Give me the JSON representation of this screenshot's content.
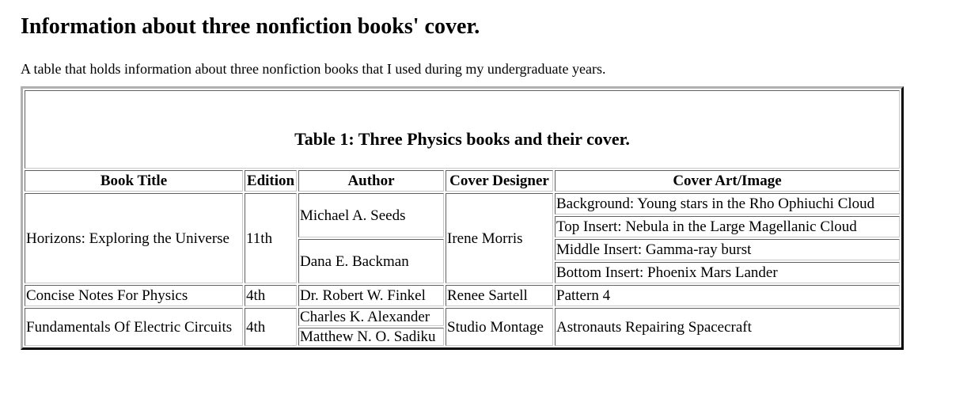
{
  "page": {
    "heading": "Information about three nonfiction books' cover.",
    "description": "A table that holds information about three nonfiction books that I used during my undergraduate years."
  },
  "table": {
    "caption": "Table 1: Three Physics books and their cover.",
    "headers": [
      "Book Title",
      "Edition",
      "Author",
      "Cover Designer",
      "Cover Art/Image"
    ],
    "books": [
      {
        "title": "Horizons: Exploring the Universe",
        "edition": "11th",
        "authors": [
          "Michael A. Seeds",
          "Dana E. Backman"
        ],
        "designer": "Irene Morris",
        "cover_art": [
          "Background: Young stars in the Rho Ophiuchi Cloud",
          "Top Insert: Nebula in the Large Magellanic Cloud",
          "Middle Insert: Gamma-ray burst",
          "Bottom Insert: Phoenix Mars Lander"
        ]
      },
      {
        "title": "Concise Notes For Physics",
        "edition": "4th",
        "authors": [
          "Dr. Robert W. Finkel"
        ],
        "designer": "Renee Sartell",
        "cover_art": [
          "Pattern 4"
        ]
      },
      {
        "title": "Fundamentals Of Electric Circuits",
        "edition": "4th",
        "authors": [
          "Charles K. Alexander",
          "Matthew N. O. Sadiku"
        ],
        "designer": "Studio Montage",
        "cover_art": [
          "Astronauts Repairing Spacecraft"
        ]
      }
    ]
  }
}
